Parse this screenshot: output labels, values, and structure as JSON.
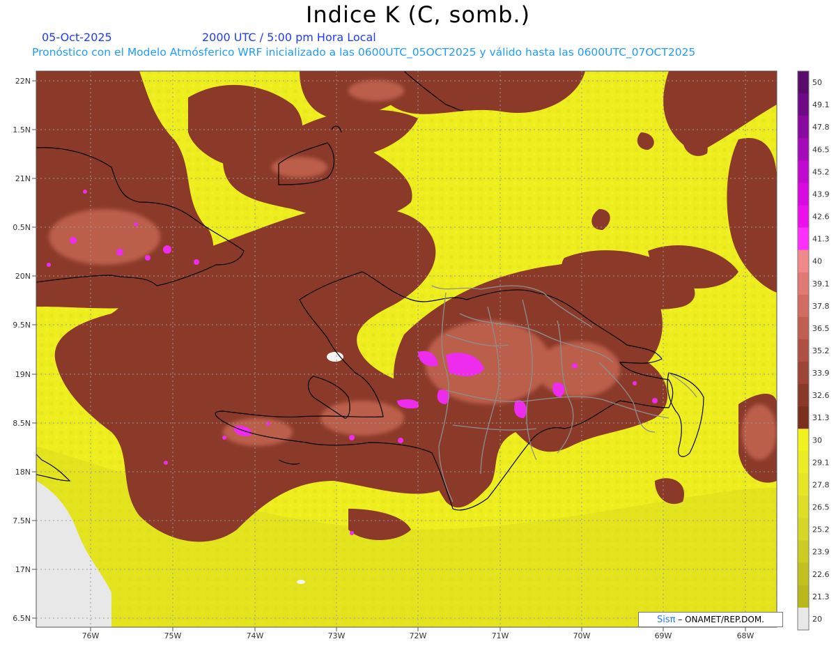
{
  "title": "Indice K (C, somb.)",
  "date": "05-Oct-2025",
  "time": "2000 UTC / 5:00 pm Hora Local",
  "forecast": "Pronóstico con el Modelo Atmósferico WRF inicializado a las 0600UTC_05OCT2025 y válido hasta las  0600UTC_07OCT2025",
  "lat_labels": [
    "22N",
    "1.5N",
    "21N",
    "0.5N",
    "20N",
    "9.5N",
    "19N",
    "8.5N",
    "18N",
    "7.5N",
    "17N",
    "6.5N"
  ],
  "lon_labels": [
    "76W",
    "75W",
    "74W",
    "73W",
    "72W",
    "71W",
    "70W",
    "69W",
    "68W"
  ],
  "colorbar": {
    "labels": [
      "50",
      "49.1",
      "47.8",
      "46.5",
      "45.2",
      "43.9",
      "42.6",
      "41.3",
      "40",
      "39.1",
      "37.8",
      "36.5",
      "35.2",
      "33.9",
      "32.6",
      "31.3",
      "30",
      "29.1",
      "27.8",
      "26.5",
      "25.2",
      "23.9",
      "22.6",
      "21.3",
      "20"
    ],
    "colors": [
      "#5a0a6a",
      "#6e0a86",
      "#8a0aa0",
      "#a50ab8",
      "#c00ad0",
      "#d80ae0",
      "#ec10ec",
      "#ff30ff",
      "#f08a8a",
      "#e07a74",
      "#d06c62",
      "#c05e52",
      "#ae5044",
      "#9c4436",
      "#8a3828",
      "#7a2e1c",
      "#f2f21e",
      "#ecec22",
      "#e6e624",
      "#dede26",
      "#d6d626",
      "#cccc22",
      "#c2c21e",
      "#b8b81a",
      "#e8e8e8"
    ]
  },
  "colors": {
    "yellow": "#eeee1e",
    "brown": "#8b3a2a",
    "pink": "#ee2cee",
    "land_gray": "#e8e8e8"
  },
  "credit": {
    "logo": "Sisπ",
    "text": " – ONAMET/REP.DOM."
  }
}
